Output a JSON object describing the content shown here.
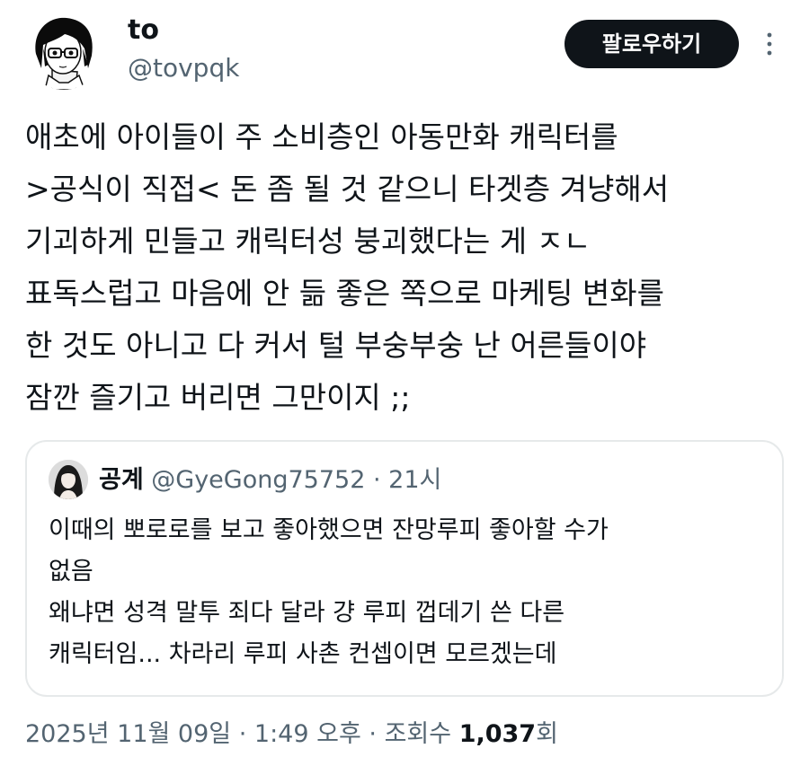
{
  "author": {
    "display_name": "to",
    "handle": "@tovpqk",
    "follow_label": "팔로우하기"
  },
  "tweet": {
    "lines": [
      "애초에 아이들이 주 소비층인 아동만화 캐릭터를",
      ">공식이 직접< 돈 좀 될 것 같으니 타겟층 겨냥해서",
      "기괴하게 민들고 캐릭터성 붕괴했다는 게 ㅈㄴ",
      "표독스럽고 마음에 안 듦 좋은 쪽으로 마케팅 변화를",
      "한 것도 아니고 다 커서 털 부숭부숭 난 어른들이야",
      "잠깐 즐기고 버리면 그만이지 ;;"
    ]
  },
  "quote": {
    "display_name": "공계",
    "handle": "@GyeGong75752",
    "separator": "·",
    "time": "21시",
    "lines": [
      "이때의 뽀로로를 보고 좋아했으면 잔망루피 좋아할 수가",
      "없음",
      "왜냐면 성격 말투 죄다 달라 걍 루피 껍데기 쓴 다른",
      "캐릭터임... 차라리 루피 사촌 컨셉이면 모르겠는데"
    ]
  },
  "meta": {
    "date": "2025년 11월 09일",
    "time": "1:49 오후",
    "views_label": "조회수",
    "views_count": "1,037",
    "views_suffix": "회"
  },
  "icons": {
    "more": "more-vertical-icon",
    "author_avatar": "avatar-image",
    "quote_avatar": "avatar-image"
  },
  "colors": {
    "text": "#0f1419",
    "secondary": "#536471",
    "button_bg": "#0f1419",
    "button_text": "#ffffff",
    "border": "#e6e9ea"
  }
}
